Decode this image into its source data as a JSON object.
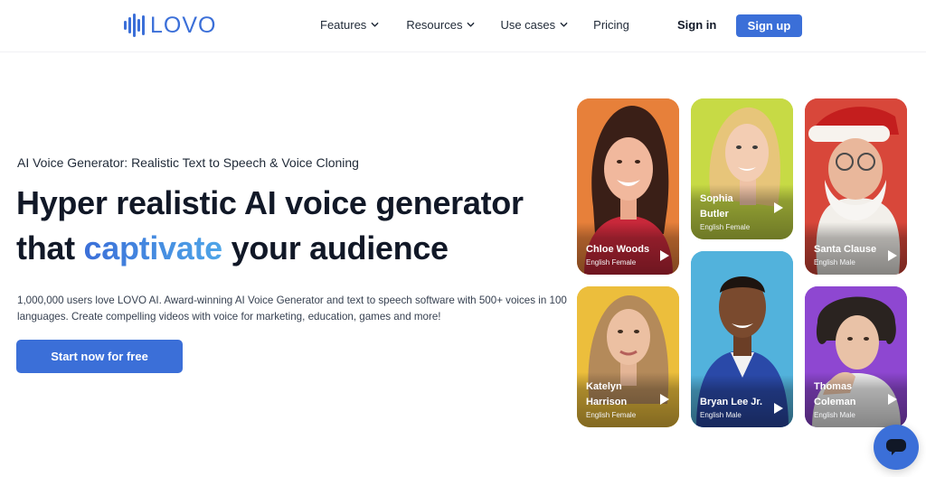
{
  "brand": {
    "name": "LOVO",
    "color": "#3b6fd8"
  },
  "nav": {
    "items": [
      {
        "label": "Features",
        "dropdown": true
      },
      {
        "label": "Resources",
        "dropdown": true
      },
      {
        "label": "Use cases",
        "dropdown": true
      },
      {
        "label": "Pricing",
        "dropdown": false
      }
    ],
    "sign_in": "Sign in",
    "sign_up": "Sign up"
  },
  "hero": {
    "subheading": "AI Voice Generator: Realistic Text to Speech & Voice Cloning",
    "headline_line1": "Hyper realistic AI voice generator",
    "headline_line2_pre": "that ",
    "headline_accent": "captivate",
    "headline_line2_post": " your audience",
    "description": "1,000,000 users love LOVO AI. Award-winning AI Voice Generator and text to speech software with 500+ voices in 100 languages. Create compelling videos with voice for marketing, education, games and more!",
    "cta": "Start now for free"
  },
  "voices": [
    {
      "name": "Chloe Woods",
      "meta": "English Female",
      "bg": "#e7803a"
    },
    {
      "name": "Sophia Butler",
      "name_lines": [
        "Sophia",
        "Butler"
      ],
      "meta": "English Female",
      "bg": "#c7da45"
    },
    {
      "name": "Santa Clause",
      "meta": "English Male",
      "bg": "#d8473a"
    },
    {
      "name": "Katelyn Harrison",
      "name_lines": [
        "Katelyn",
        "Harrison"
      ],
      "meta": "English Female",
      "bg": "#ecbe3c"
    },
    {
      "name": "Bryan Lee Jr.",
      "meta": "English Male",
      "bg": "#52b2dc"
    },
    {
      "name": "Thomas Coleman",
      "name_lines": [
        "Thomas",
        "Coleman"
      ],
      "meta": "English Male",
      "bg": "#8e47d1"
    }
  ],
  "icons": {
    "chevron": "chevron-down-icon",
    "play": "play-icon",
    "chat": "chat-icon"
  }
}
